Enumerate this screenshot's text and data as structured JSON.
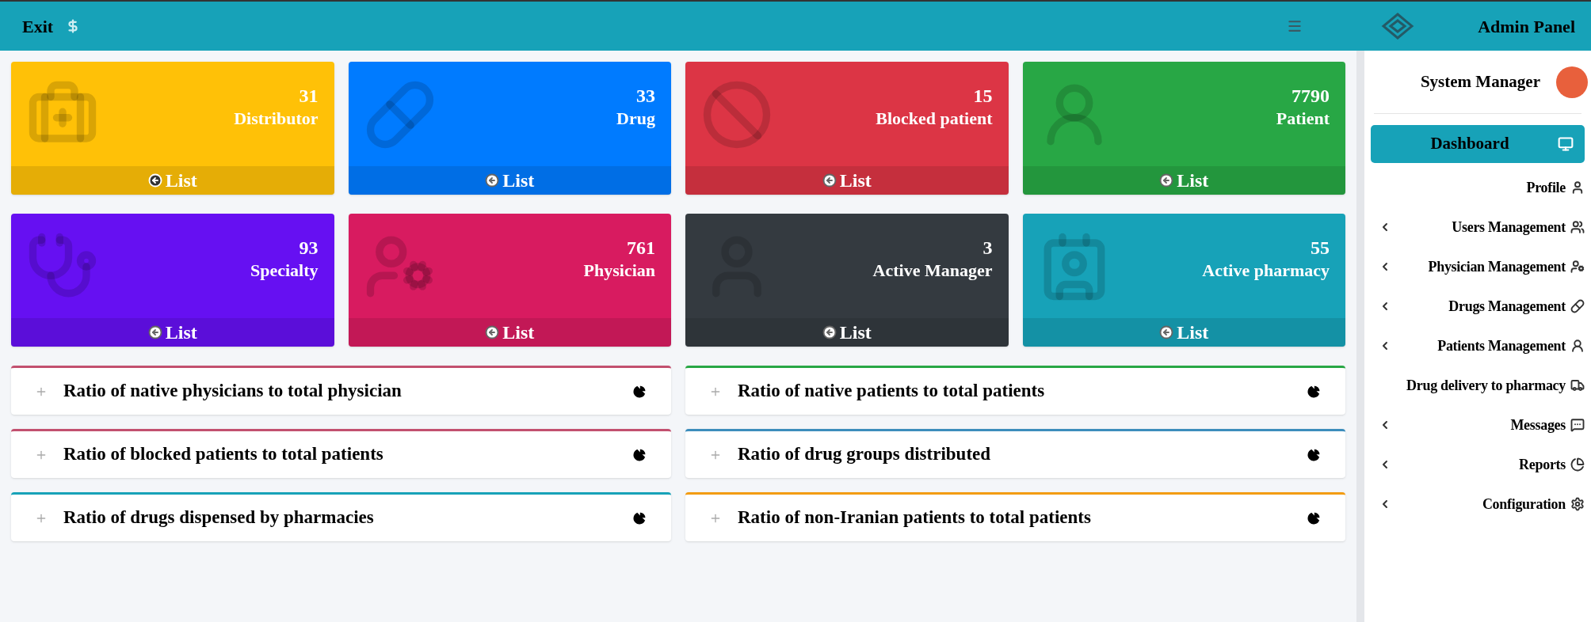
{
  "header": {
    "exit": "Exit",
    "title": "Admin Panel"
  },
  "cards": [
    {
      "count": "31",
      "label": "Distributor",
      "link": "List",
      "color": "#ffc107"
    },
    {
      "count": "33",
      "label": "Drug",
      "link": "List",
      "color": "#007bff"
    },
    {
      "count": "15",
      "label": "Blocked patient",
      "link": "List",
      "color": "#dc3545"
    },
    {
      "count": "7790",
      "label": "Patient",
      "link": "List",
      "color": "#28a745"
    },
    {
      "count": "93",
      "label": "Specialty",
      "link": "List",
      "color": "#6610f2"
    },
    {
      "count": "761",
      "label": "Physician",
      "link": "List",
      "color": "#d81b60"
    },
    {
      "count": "3",
      "label": "Active Manager",
      "link": "List",
      "color": "#343a40"
    },
    {
      "count": "55",
      "label": "Active pharmacy",
      "link": "List",
      "color": "#17a2b8"
    }
  ],
  "panels": [
    {
      "title": "Ratio of native physicians to total physician",
      "color": "#c2506f"
    },
    {
      "title": "Ratio of native patients to total patients",
      "color": "#28a745"
    },
    {
      "title": "Ratio of blocked patients to total patients",
      "color": "#c2506f"
    },
    {
      "title": "Ratio of drug groups distributed",
      "color": "#3c8dbc"
    },
    {
      "title": "Ratio of drugs dispensed by pharmacies",
      "color": "#17a2b8"
    },
    {
      "title": "Ratio of non-Iranian patients to total patients",
      "color": "#f39c12"
    }
  ],
  "sidebar": {
    "user": "System Manager",
    "items": [
      {
        "label": "Dashboard",
        "selected": true,
        "expandable": false
      },
      {
        "label": "Profile",
        "selected": false,
        "expandable": false
      },
      {
        "label": "Users Management",
        "selected": false,
        "expandable": true
      },
      {
        "label": "Physician Management",
        "selected": false,
        "expandable": true
      },
      {
        "label": "Drugs Management",
        "selected": false,
        "expandable": true
      },
      {
        "label": "Patients Management",
        "selected": false,
        "expandable": true
      },
      {
        "label": "Drug delivery to pharmacy",
        "selected": false,
        "expandable": false
      },
      {
        "label": "Messages",
        "selected": false,
        "expandable": true
      },
      {
        "label": "Reports",
        "selected": false,
        "expandable": true
      },
      {
        "label": "Configuration",
        "selected": false,
        "expandable": true
      }
    ]
  }
}
